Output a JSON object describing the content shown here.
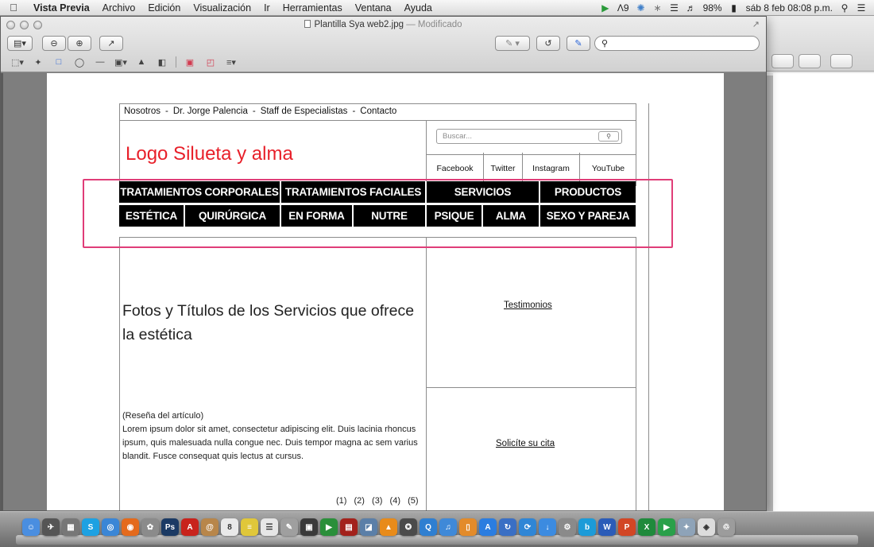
{
  "menubar": {
    "app_name": "Vista Previa",
    "items": [
      "Archivo",
      "Edición",
      "Visualización",
      "Ir",
      "Herramientas",
      "Ventana",
      "Ayuda"
    ],
    "status": {
      "adobe_badge": "9",
      "battery": "98%",
      "datetime": "sáb 8 feb  08:08 p.m."
    }
  },
  "window": {
    "filename": "Plantilla Sya web2.jpg",
    "modified_suffix": "— Modificado",
    "rotate_label": "↺"
  },
  "wireframe": {
    "nav_links": [
      "Nosotros",
      "Dr. Jorge Palencia",
      "Staff de Especialistas",
      "Contacto"
    ],
    "nav_separator": "-",
    "logo_text": "Logo Silueta y alma",
    "search_placeholder": "Buscar...",
    "social": [
      "Facebook",
      "Twitter",
      "Instagram",
      "YouTube"
    ],
    "menu_row1": [
      "TRATAMIENTOS CORPORALES",
      "TRATAMIENTOS FACIALES",
      "SERVICIOS",
      "PRODUCTOS"
    ],
    "menu_row2": [
      "ESTÉTICA",
      "QUIRÚRGICA",
      "EN FORMA",
      "NUTRE",
      "PSIQUE",
      "ALMA",
      "SEXO Y PAREJA"
    ],
    "main_title": "Fotos y Títulos de los Servicios que ofrece la estética",
    "review_label": "(Reseña del artículo)",
    "lorem": "Lorem ipsum dolor sit amet, consectetur adipiscing elit. Duis lacinia rhoncus ipsum, quis malesuada nulla congue nec. Duis tempor magna ac sem varius blandit. Fusce consequat quis lectus at cursus.",
    "pager": [
      "(1)",
      "(2)",
      "(3)",
      "(4)",
      "(5)"
    ],
    "testimonios": "Testimonios",
    "cita": "Solicíte su cita"
  },
  "dock_items": [
    {
      "name": "finder-icon",
      "color": "#4a8ee0",
      "glyph": "☺"
    },
    {
      "name": "launchpad-icon",
      "color": "#555555",
      "glyph": "✈"
    },
    {
      "name": "system-app-icon",
      "color": "#777777",
      "glyph": "▦"
    },
    {
      "name": "skype-icon",
      "color": "#1da1e2",
      "glyph": "S"
    },
    {
      "name": "safari-icon",
      "color": "#3a86d6",
      "glyph": "◎"
    },
    {
      "name": "firefox-icon",
      "color": "#e46a1c",
      "glyph": "◉"
    },
    {
      "name": "utility-icon",
      "color": "#8b8b8b",
      "glyph": "✿"
    },
    {
      "name": "photoshop-icon",
      "color": "#1b3a64",
      "glyph": "Ps"
    },
    {
      "name": "acrobat-icon",
      "color": "#c8231c",
      "glyph": "A"
    },
    {
      "name": "contacts-icon",
      "color": "#b8864a",
      "glyph": "@"
    },
    {
      "name": "calendar-icon",
      "color": "#e9e9e9",
      "glyph": "8"
    },
    {
      "name": "notes-icon",
      "color": "#e0c73a",
      "glyph": "≡"
    },
    {
      "name": "reminders-icon",
      "color": "#e6e6e6",
      "glyph": "☰"
    },
    {
      "name": "preview-icon",
      "color": "#9f9f9f",
      "glyph": "✎"
    },
    {
      "name": "photobooth-icon",
      "color": "#3a3a3a",
      "glyph": "▣"
    },
    {
      "name": "facetime-icon",
      "color": "#2a8f3a",
      "glyph": "▶"
    },
    {
      "name": "photo-icon",
      "color": "#a3221c",
      "glyph": "▤"
    },
    {
      "name": "iphoto-icon",
      "color": "#5b7fa8",
      "glyph": "◪"
    },
    {
      "name": "vlc-icon",
      "color": "#e88b1a",
      "glyph": "▲"
    },
    {
      "name": "imovie-icon",
      "color": "#4b4b4b",
      "glyph": "✪"
    },
    {
      "name": "quicktime-icon",
      "color": "#2f7fd1",
      "glyph": "Q"
    },
    {
      "name": "itunes-icon",
      "color": "#3f89d8",
      "glyph": "♫"
    },
    {
      "name": "ibooks-icon",
      "color": "#e38b2a",
      "glyph": "▯"
    },
    {
      "name": "appstore-icon",
      "color": "#2b7de0",
      "glyph": "A"
    },
    {
      "name": "migration-icon",
      "color": "#3a6fc4",
      "glyph": "↻"
    },
    {
      "name": "sync-icon",
      "color": "#2f86d6",
      "glyph": "⟳"
    },
    {
      "name": "download-icon",
      "color": "#3c8be0",
      "glyph": "↓"
    },
    {
      "name": "preferences-icon",
      "color": "#8a8a8a",
      "glyph": "⚙"
    },
    {
      "name": "blurb-icon",
      "color": "#1c9bd8",
      "glyph": "b"
    },
    {
      "name": "word-icon",
      "color": "#2b5cb8",
      "glyph": "W"
    },
    {
      "name": "powerpoint-icon",
      "color": "#d24625",
      "glyph": "P"
    },
    {
      "name": "excel-icon",
      "color": "#1f8a3c",
      "glyph": "X"
    },
    {
      "name": "media-icon",
      "color": "#29a04a",
      "glyph": "▶"
    },
    {
      "name": "network-icon",
      "color": "#8ea3b8",
      "glyph": "✦"
    },
    {
      "name": "unity-icon",
      "color": "#dcdcdc",
      "glyph": "◈"
    },
    {
      "name": "trash-icon",
      "color": "#9c9c9c",
      "glyph": "♲"
    }
  ]
}
